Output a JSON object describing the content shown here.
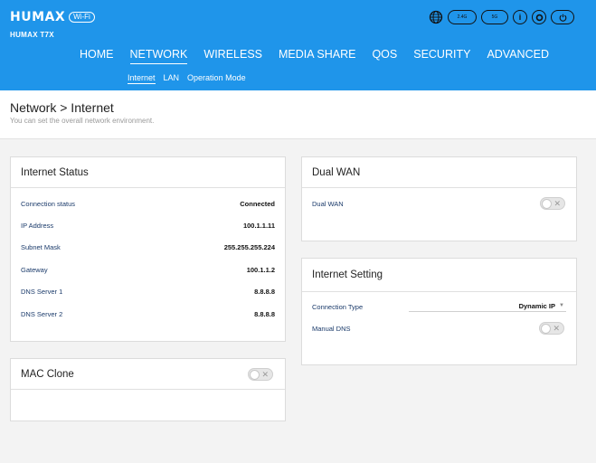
{
  "brand": {
    "logo": "HUMAX",
    "logo_badge": "Wi-Fi",
    "model": "HUMAX T7X"
  },
  "top_icons": [
    {
      "name": "globe-icon"
    },
    {
      "name": "band-2g-icon",
      "label": "2.4G"
    },
    {
      "name": "band-5g-icon",
      "label": "5G"
    },
    {
      "name": "info-icon",
      "label": "i"
    },
    {
      "name": "settings-icon"
    },
    {
      "name": "power-icon"
    }
  ],
  "nav": {
    "items": [
      "HOME",
      "NETWORK",
      "WIRELESS",
      "MEDIA SHARE",
      "QOS",
      "SECURITY",
      "ADVANCED"
    ],
    "active": "NETWORK"
  },
  "subnav": {
    "items": [
      "Internet",
      "LAN",
      "Operation Mode"
    ],
    "active": "Internet"
  },
  "page": {
    "title": "Network > Internet",
    "subtitle": "You can set the overall network environment."
  },
  "internet_status": {
    "title": "Internet Status",
    "rows": [
      {
        "label": "Connection status",
        "value": "Connected"
      },
      {
        "label": "IP Address",
        "value": "100.1.1.11"
      },
      {
        "label": "Subnet Mask",
        "value": "255.255.255.224"
      },
      {
        "label": "Gateway",
        "value": "100.1.1.2"
      },
      {
        "label": "DNS Server 1",
        "value": "8.8.8.8"
      },
      {
        "label": "DNS Server 2",
        "value": "8.8.8.8"
      }
    ]
  },
  "mac_clone": {
    "title": "MAC Clone",
    "enabled": false
  },
  "dual_wan": {
    "title": "Dual WAN",
    "row_label": "Dual WAN",
    "enabled": false
  },
  "internet_setting": {
    "title": "Internet Setting",
    "connection_type_label": "Connection Type",
    "connection_type_value": "Dynamic IP",
    "manual_dns_label": "Manual DNS",
    "manual_dns_enabled": false
  },
  "colors": {
    "header_bg": "#1f95ea",
    "page_bg": "#f3f3f3"
  }
}
